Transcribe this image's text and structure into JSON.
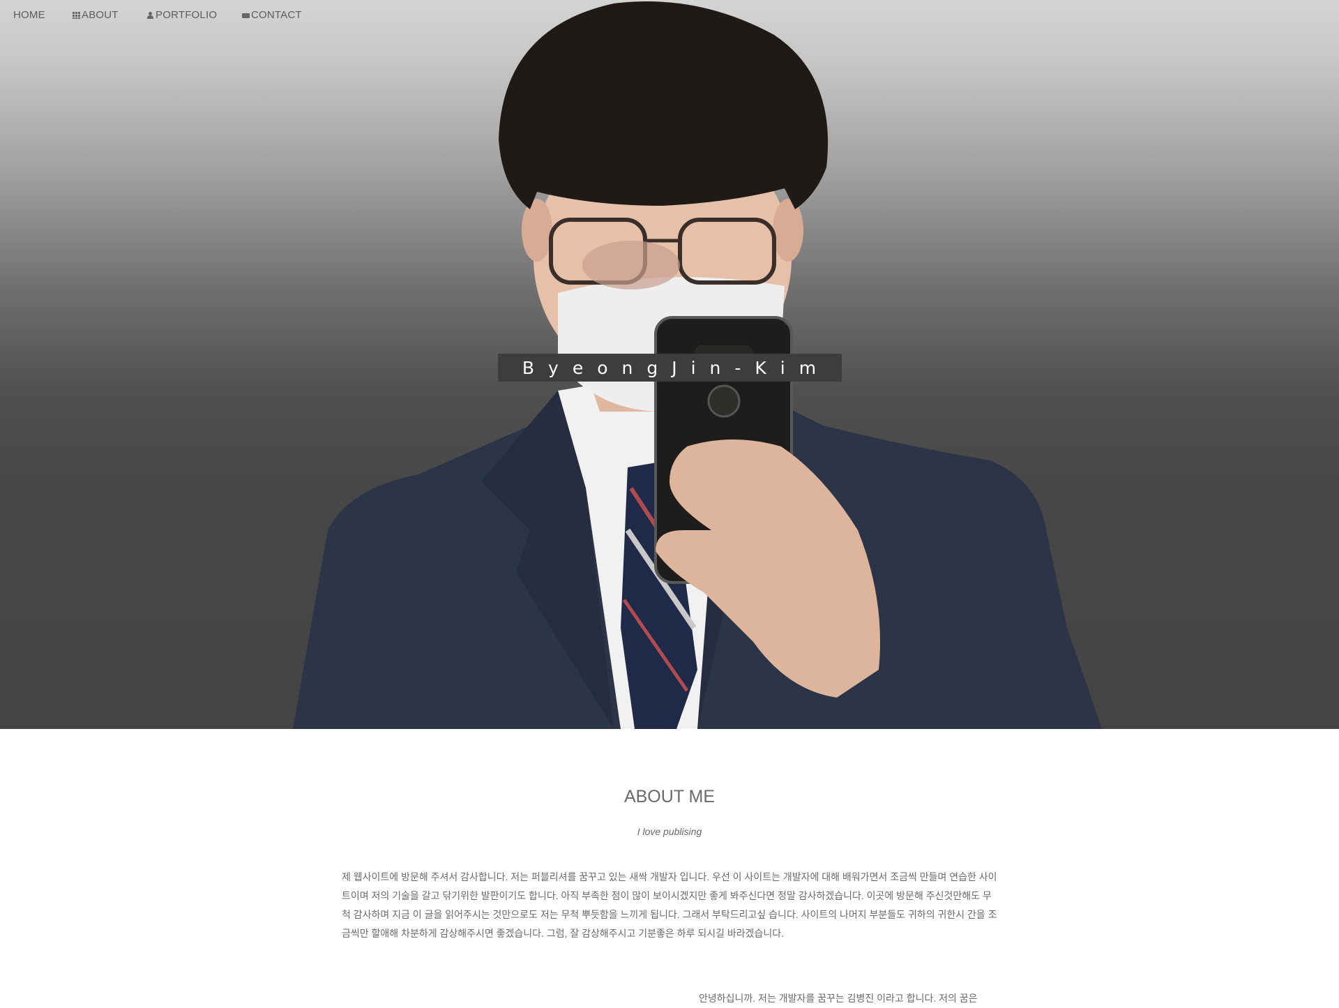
{
  "nav": {
    "home": "HOME",
    "about": "ABOUT",
    "portfolio": "PORTFOLIO",
    "contact": "CONTACT",
    "about_icon": "grid-icon",
    "portfolio_icon": "user-icon",
    "contact_icon": "envelope-icon"
  },
  "hero": {
    "name": "ByeongJin-Kim",
    "photo_description_icon": "portrait-photo"
  },
  "about": {
    "title": "ABOUT ME",
    "subtitle": "I love publising",
    "body": "제 웹사이트에 방문해 주셔서 감사합니다. 저는 퍼블리셔를 꿈꾸고 있는 새싹 개발자 입니다. 우선 이 사이트는 개발자에 대해 배워가면서 조금씩 만들며 연습한 사이트이며 저의 기술을 갈고 닦기위한 발판이기도 합니다. 아직 부족한 점이 많이 보이시겠지만 좋게 봐주신다면 정말 감사하겠습니다. 이곳에 방문해 주신것만해도 무척 감사하며 지금 이 글을 읽어주시는 것만으로도 저는 무척 뿌듯함을 느끼게 됩니다. 그래서 부탁드리고싶 습니다. 사이트의 나머지 부분들도 귀하의 귀한시 간을 조금씩만 할애해  차분하게 감상해주시면 좋겠습니다. 그럼, 잘 감상해주시고 기분좋은 하루 되시길 바라겠습니다.",
    "intro": "안녕하십니까. 저는 개발자를 꿈꾸는 김병진 이라고 합니다. 저의 꿈은"
  }
}
